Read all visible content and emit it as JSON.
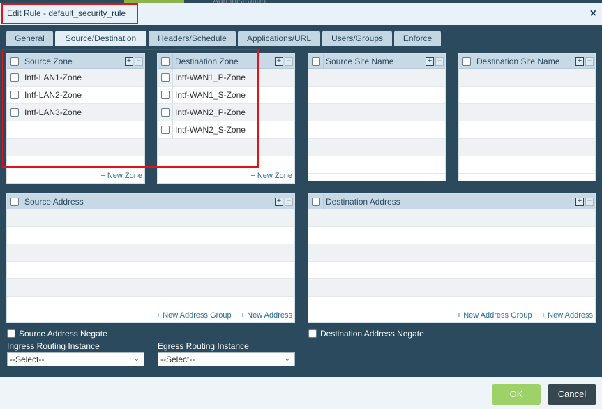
{
  "background": {
    "tab_hint": "Administration"
  },
  "dialog": {
    "title": "Edit Rule - default_security_rule",
    "close_glyph": "×"
  },
  "tabs": [
    {
      "label": "General",
      "active": false
    },
    {
      "label": "Source/Destination",
      "active": true
    },
    {
      "label": "Headers/Schedule",
      "active": false
    },
    {
      "label": "Applications/URL",
      "active": false
    },
    {
      "label": "Users/Groups",
      "active": false
    },
    {
      "label": "Enforce",
      "active": false
    }
  ],
  "source_zone": {
    "header": "Source Zone",
    "rows": [
      "Intf-LAN1-Zone",
      "Intf-LAN2-Zone",
      "Intf-LAN3-Zone"
    ],
    "footer_link": "+ New Zone"
  },
  "destination_zone": {
    "header": "Destination Zone",
    "rows": [
      "Intf-WAN1_P-Zone",
      "Intf-WAN1_S-Zone",
      "Intf-WAN2_P-Zone",
      "Intf-WAN2_S-Zone"
    ],
    "footer_link": "+ New Zone"
  },
  "source_site": {
    "header": "Source Site Name"
  },
  "destination_site": {
    "header": "Destination Site Name"
  },
  "source_address": {
    "header": "Source Address",
    "links": [
      "+ New Address Group",
      "+ New Address"
    ]
  },
  "destination_address": {
    "header": "Destination Address",
    "links": [
      "+ New Address Group",
      "+ New Address"
    ]
  },
  "source_negate": "Source Address Negate",
  "destination_negate": "Destination Address Negate",
  "ingress": {
    "label": "Ingress Routing Instance",
    "value": "--Select--"
  },
  "egress": {
    "label": "Egress Routing Instance",
    "value": "--Select--"
  },
  "buttons": {
    "ok": "OK",
    "cancel": "Cancel"
  },
  "colors": {
    "highlight": "#e0141b",
    "ok": "#9fd169",
    "cancel": "#37474f",
    "panel": "#2c4a5e"
  }
}
